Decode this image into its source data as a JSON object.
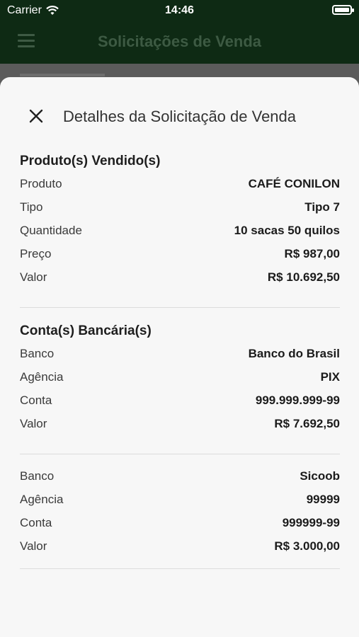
{
  "status_bar": {
    "carrier": "Carrier",
    "time": "14:46"
  },
  "app_bar": {
    "title": "Solicitações de Venda"
  },
  "sheet": {
    "title": "Detalhes da Solicitação de Venda",
    "products": {
      "heading": "Produto(s) Vendido(s)",
      "rows": [
        {
          "label": "Produto",
          "value": "CAFÉ CONILON"
        },
        {
          "label": "Tipo",
          "value": "Tipo 7"
        },
        {
          "label": "Quantidade",
          "value": "10 sacas 50 quilos"
        },
        {
          "label": "Preço",
          "value": "R$ 987,00"
        },
        {
          "label": "Valor",
          "value": "R$ 10.692,50"
        }
      ]
    },
    "accounts": {
      "heading": "Conta(s) Bancária(s)",
      "items": [
        {
          "rows": [
            {
              "label": "Banco",
              "value": "Banco do Brasil"
            },
            {
              "label": "Agência",
              "value": "PIX"
            },
            {
              "label": "Conta",
              "value": "999.999.999-99"
            },
            {
              "label": "Valor",
              "value": "R$ 7.692,50"
            }
          ]
        },
        {
          "rows": [
            {
              "label": "Banco",
              "value": "Sicoob"
            },
            {
              "label": "Agência",
              "value": "99999"
            },
            {
              "label": "Conta",
              "value": "999999-99"
            },
            {
              "label": "Valor",
              "value": "R$ 3.000,00"
            }
          ]
        }
      ]
    }
  }
}
